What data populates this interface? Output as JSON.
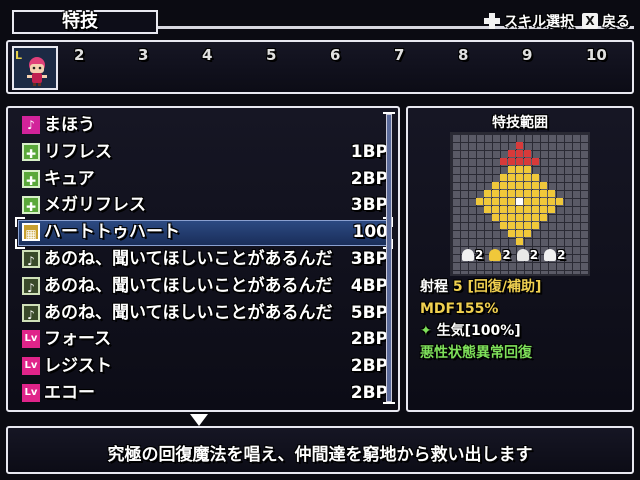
{
  "header": {
    "title": "特技",
    "hint_select": "スキル選択",
    "hint_back": "戻る",
    "hint_back_key": "X"
  },
  "party": {
    "selected_badge": "L",
    "slots": [
      "2",
      "3",
      "4",
      "5",
      "6",
      "7",
      "8",
      "9",
      "10"
    ]
  },
  "skills": [
    {
      "icon": "magic-book-icon",
      "icon_glyph": "♪",
      "icon_class": "ico-magic",
      "name": "まほう",
      "cost": ""
    },
    {
      "icon": "heal-cross-icon",
      "icon_glyph": "✚",
      "icon_class": "ico-heal",
      "name": "リフレス",
      "cost": "1BP"
    },
    {
      "icon": "heal-cross-icon",
      "icon_glyph": "✚",
      "icon_class": "ico-heal",
      "name": "キュア",
      "cost": "2BP"
    },
    {
      "icon": "heal-cross-icon",
      "icon_glyph": "✚",
      "icon_class": "ico-heal",
      "name": "メガリフレス",
      "cost": "3BP"
    },
    {
      "icon": "heart-to-heart-icon",
      "icon_glyph": "▦",
      "icon_class": "ico-hh",
      "name": "ハートトゥハート",
      "cost": "100"
    },
    {
      "icon": "music-note-icon",
      "icon_glyph": "♪",
      "icon_class": "ico-song",
      "name": "あのね、聞いてほしいことがあるんだ",
      "cost": "3BP"
    },
    {
      "icon": "music-note-plus-icon",
      "icon_glyph": "♪",
      "icon_class": "ico-song",
      "name": "あのね、聞いてほしいことがあるんだ",
      "cost": "4BP"
    },
    {
      "icon": "music-note-plus-icon",
      "icon_glyph": "♪",
      "icon_class": "ico-song",
      "name": "あのね、聞いてほしいことがあるんだ",
      "cost": "5BP"
    },
    {
      "icon": "level-icon",
      "icon_glyph": "Lv",
      "icon_class": "ico-lv",
      "name": "フォース",
      "cost": "2BP"
    },
    {
      "icon": "level-icon",
      "icon_glyph": "Lv",
      "icon_class": "ico-lv",
      "name": "レジスト",
      "cost": "2BP"
    },
    {
      "icon": "level-icon",
      "icon_glyph": "Lv",
      "icon_class": "ico-lv",
      "name": "エコー",
      "cost": "2BP"
    }
  ],
  "selected_index": 4,
  "range_panel": {
    "title": "特技範囲",
    "elements": [
      "2",
      "2",
      "2",
      "2"
    ],
    "range_label": "射程",
    "range_value": "5",
    "range_type": "[回復/補助]",
    "mdf": "MDF155%",
    "status": "生気[100%]",
    "effect": "悪性状態異常回復"
  },
  "description": "究極の回復魔法を唱え、仲間達を窮地から救い出します",
  "colors": {
    "range_red": "#d83a3a",
    "range_yellow": "#f0c83a",
    "range_center": "#ffffff",
    "highlight": "#2c4a82"
  }
}
